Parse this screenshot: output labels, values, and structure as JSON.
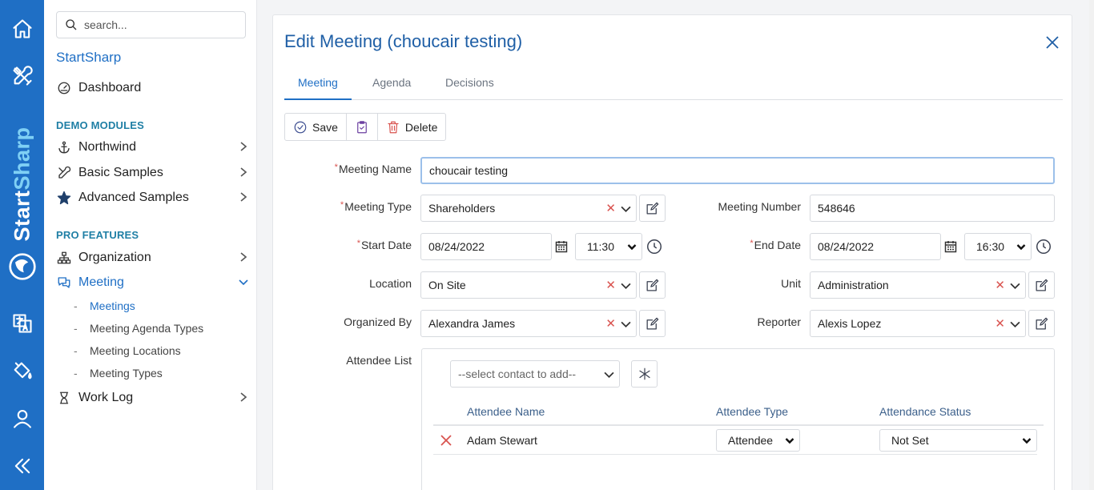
{
  "rail": {
    "brand_part1": "Start",
    "brand_part2": "Sharp",
    "icons": [
      "home-icon",
      "tools-icon",
      "translate-icon",
      "paint-bucket-icon",
      "user-icon",
      "collapse-icon"
    ]
  },
  "sidebar": {
    "search_placeholder": "search...",
    "brand": "StartSharp",
    "dashboard": "Dashboard",
    "demo_modules_title": "DEMO MODULES",
    "northwind": "Northwind",
    "basic_samples": "Basic Samples",
    "advanced_samples": "Advanced Samples",
    "pro_features_title": "PRO FEATURES",
    "organization": "Organization",
    "meeting": "Meeting",
    "meeting_children": [
      "Meetings",
      "Meeting Agenda Types",
      "Meeting Locations",
      "Meeting Types"
    ],
    "work_log": "Work Log"
  },
  "dialog": {
    "title": "Edit Meeting (choucair testing)",
    "tabs": [
      "Meeting",
      "Agenda",
      "Decisions"
    ],
    "toolbar": {
      "save": "Save",
      "delete": "Delete"
    },
    "fields": {
      "meeting_name_label": "Meeting Name",
      "meeting_name_value": "choucair testing",
      "meeting_type_label": "Meeting Type",
      "meeting_type_value": "Shareholders",
      "meeting_number_label": "Meeting Number",
      "meeting_number_value": "548646",
      "start_date_label": "Start Date",
      "start_date_value": "08/24/2022",
      "start_time_value": "11:30",
      "end_date_label": "End Date",
      "end_date_value": "08/24/2022",
      "end_time_value": "16:30",
      "location_label": "Location",
      "location_value": "On Site",
      "unit_label": "Unit",
      "unit_value": "Administration",
      "organized_by_label": "Organized By",
      "organized_by_value": "Alexandra James",
      "reporter_label": "Reporter",
      "reporter_value": "Alexis Lopez",
      "attendee_list_label": "Attendee List"
    },
    "attendees": {
      "contact_placeholder": "--select contact to add--",
      "columns": [
        "Attendee Name",
        "Attendee Type",
        "Attendance Status"
      ],
      "rows": [
        {
          "name": "Adam Stewart",
          "type": "Attendee",
          "status": "Not Set"
        }
      ]
    }
  }
}
